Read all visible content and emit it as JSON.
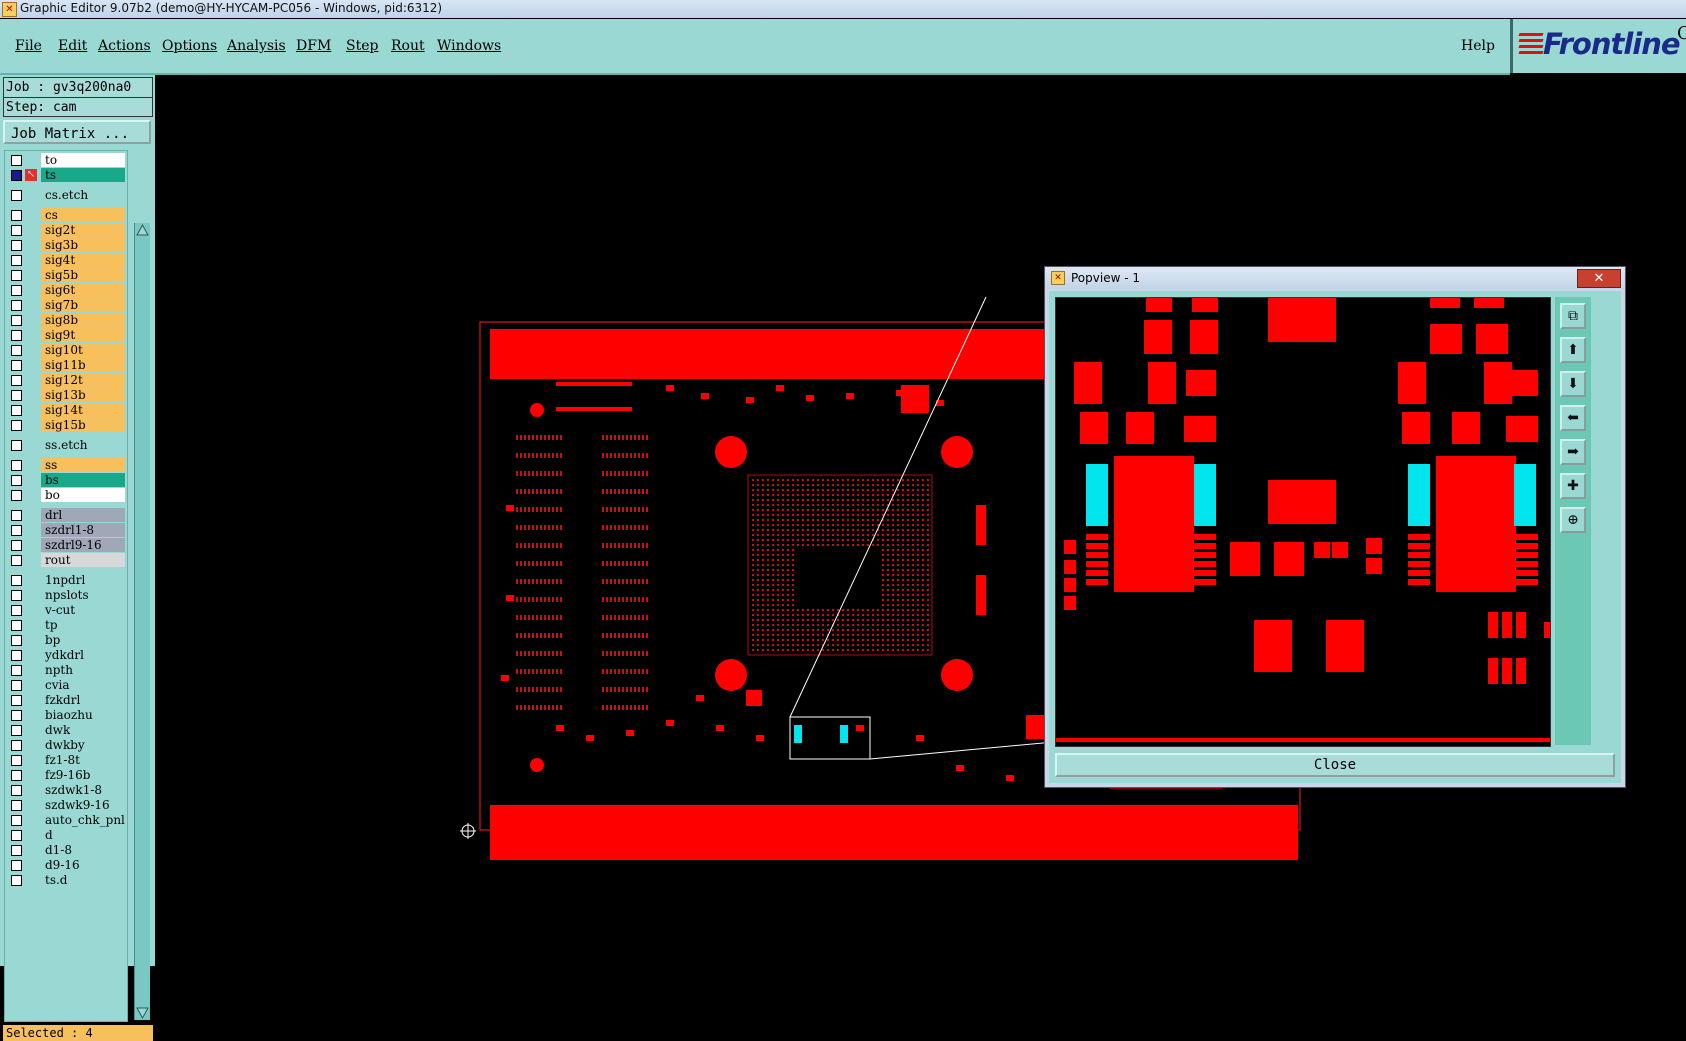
{
  "window": {
    "title": "Graphic Editor 9.07b2 (demo@HY-HYCAM-PC056 - Windows, pid:6312)"
  },
  "menu": {
    "items": [
      "File",
      "Edit",
      "Actions",
      "Options",
      "Analysis",
      "DFM",
      "Step",
      "Rout",
      "Windows"
    ],
    "help": "Help"
  },
  "logo": {
    "text": "Frontline",
    "extra": "C"
  },
  "job": {
    "job_line": "Job : gv3q200na0",
    "step_line": "Step: cam",
    "matrix_button": "Job Matrix ..."
  },
  "layers": [
    {
      "name": "to",
      "color": "#ffffff"
    },
    {
      "name": "ts",
      "color": "#1aa88a",
      "active": true
    },
    {
      "name": "cs.etch",
      "color": "#9ad8d4"
    },
    {
      "name": "cs",
      "color": "#f8c05c"
    },
    {
      "name": "sig2t",
      "color": "#f8c05c"
    },
    {
      "name": "sig3b",
      "color": "#f8c05c"
    },
    {
      "name": "sig4t",
      "color": "#f8c05c"
    },
    {
      "name": "sig5b",
      "color": "#f8c05c"
    },
    {
      "name": "sig6t",
      "color": "#f8c05c"
    },
    {
      "name": "sig7b",
      "color": "#f8c05c"
    },
    {
      "name": "sig8b",
      "color": "#f8c05c"
    },
    {
      "name": "sig9t",
      "color": "#f8c05c"
    },
    {
      "name": "sig10t",
      "color": "#f8c05c"
    },
    {
      "name": "sig11b",
      "color": "#f8c05c"
    },
    {
      "name": "sig12t",
      "color": "#f8c05c"
    },
    {
      "name": "sig13b",
      "color": "#f8c05c"
    },
    {
      "name": "sig14t",
      "color": "#f8c05c"
    },
    {
      "name": "sig15b",
      "color": "#f8c05c"
    },
    {
      "name": "ss.etch",
      "color": "#9ad8d4"
    },
    {
      "name": "ss",
      "color": "#f8c05c"
    },
    {
      "name": "bs",
      "color": "#1aa88a"
    },
    {
      "name": "bo",
      "color": "#ffffff"
    },
    {
      "name": "drl",
      "color": "#a0a8b8"
    },
    {
      "name": "szdrl1-8",
      "color": "#a0a8b8"
    },
    {
      "name": "szdrl9-16",
      "color": "#a0a8b8"
    },
    {
      "name": "rout",
      "color": "#d8d8d8"
    },
    {
      "name": "1npdrl",
      "color": "#9ad8d4"
    },
    {
      "name": "npslots",
      "color": "#9ad8d4"
    },
    {
      "name": "v-cut",
      "color": "#9ad8d4"
    },
    {
      "name": "tp",
      "color": "#9ad8d4"
    },
    {
      "name": "bp",
      "color": "#9ad8d4"
    },
    {
      "name": "ydkdrl",
      "color": "#9ad8d4"
    },
    {
      "name": "npth",
      "color": "#9ad8d4"
    },
    {
      "name": "cvia",
      "color": "#9ad8d4"
    },
    {
      "name": "fzkdrl",
      "color": "#9ad8d4"
    },
    {
      "name": "biaozhu",
      "color": "#9ad8d4"
    },
    {
      "name": "dwk",
      "color": "#9ad8d4"
    },
    {
      "name": "dwkby",
      "color": "#9ad8d4"
    },
    {
      "name": "fz1-8t",
      "color": "#9ad8d4"
    },
    {
      "name": "fz9-16b",
      "color": "#9ad8d4"
    },
    {
      "name": "szdwk1-8",
      "color": "#9ad8d4"
    },
    {
      "name": "szdwk9-16",
      "color": "#9ad8d4"
    },
    {
      "name": "auto_chk_pnl",
      "color": "#9ad8d4"
    },
    {
      "name": "d",
      "color": "#9ad8d4"
    },
    {
      "name": "d1-8",
      "color": "#9ad8d4"
    },
    {
      "name": "d9-16",
      "color": "#9ad8d4"
    },
    {
      "name": "ts.d",
      "color": "#9ad8d4"
    }
  ],
  "status": {
    "selected": "Selected : 4"
  },
  "popview": {
    "title": "Popview - 1",
    "close_label": "Close",
    "close_x": "✕"
  },
  "colors": {
    "pad": "#ff0000",
    "cyan_pad": "#00e5ee",
    "panel_bg": "#9ad8d4"
  }
}
